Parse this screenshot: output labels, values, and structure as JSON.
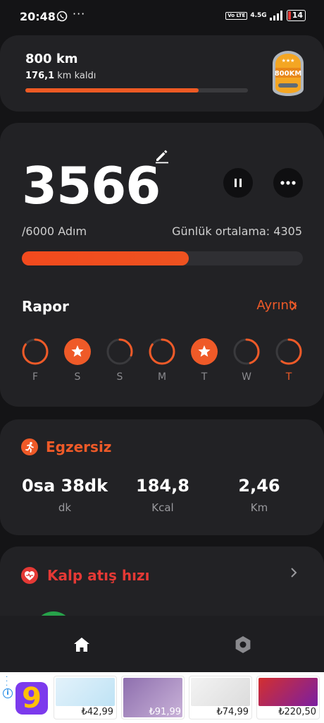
{
  "status_bar": {
    "time": "20:48",
    "more": "···",
    "volte": "Vo LTE",
    "network": "4.5G",
    "battery": "14"
  },
  "goal": {
    "title": "800 km",
    "remaining_value": "176,1",
    "remaining_label": "km kaldı",
    "progress_fraction": 0.78,
    "badge_text": "800KM"
  },
  "steps": {
    "count": "3566",
    "goal_text": "/6000 Adım",
    "average_text": "Günlük ortalama: 4305",
    "progress_fraction": 0.594
  },
  "report": {
    "title": "Rapor",
    "details_link": "Ayrıntı",
    "days": [
      {
        "label": "F",
        "progress": 0.85,
        "star": false,
        "today": false
      },
      {
        "label": "S",
        "progress": 1.0,
        "star": true,
        "today": false
      },
      {
        "label": "S",
        "progress": 0.3,
        "star": false,
        "today": false
      },
      {
        "label": "M",
        "progress": 0.85,
        "star": false,
        "today": false
      },
      {
        "label": "T",
        "progress": 1.0,
        "star": true,
        "today": false
      },
      {
        "label": "W",
        "progress": 0.45,
        "star": false,
        "today": false
      },
      {
        "label": "T",
        "progress": 0.6,
        "star": false,
        "today": true
      }
    ]
  },
  "exercise": {
    "title": "Egzersiz",
    "duration_value": "0sa 38dk",
    "duration_unit": "dk",
    "calories_value": "184,8",
    "calories_unit": "Kcal",
    "distance_value": "2,46",
    "distance_unit": "Km"
  },
  "heart_rate": {
    "title": "Kalp atış hızı"
  },
  "ads": {
    "logo_char": "9",
    "items": [
      {
        "price": "₺42,99"
      },
      {
        "price": "₺91,99"
      },
      {
        "price": "₺74,99"
      },
      {
        "price": "₺220,50"
      }
    ]
  },
  "colors": {
    "accent": "#ef5a28",
    "heart": "#e53935",
    "card": "#222225",
    "background": "#141416"
  }
}
